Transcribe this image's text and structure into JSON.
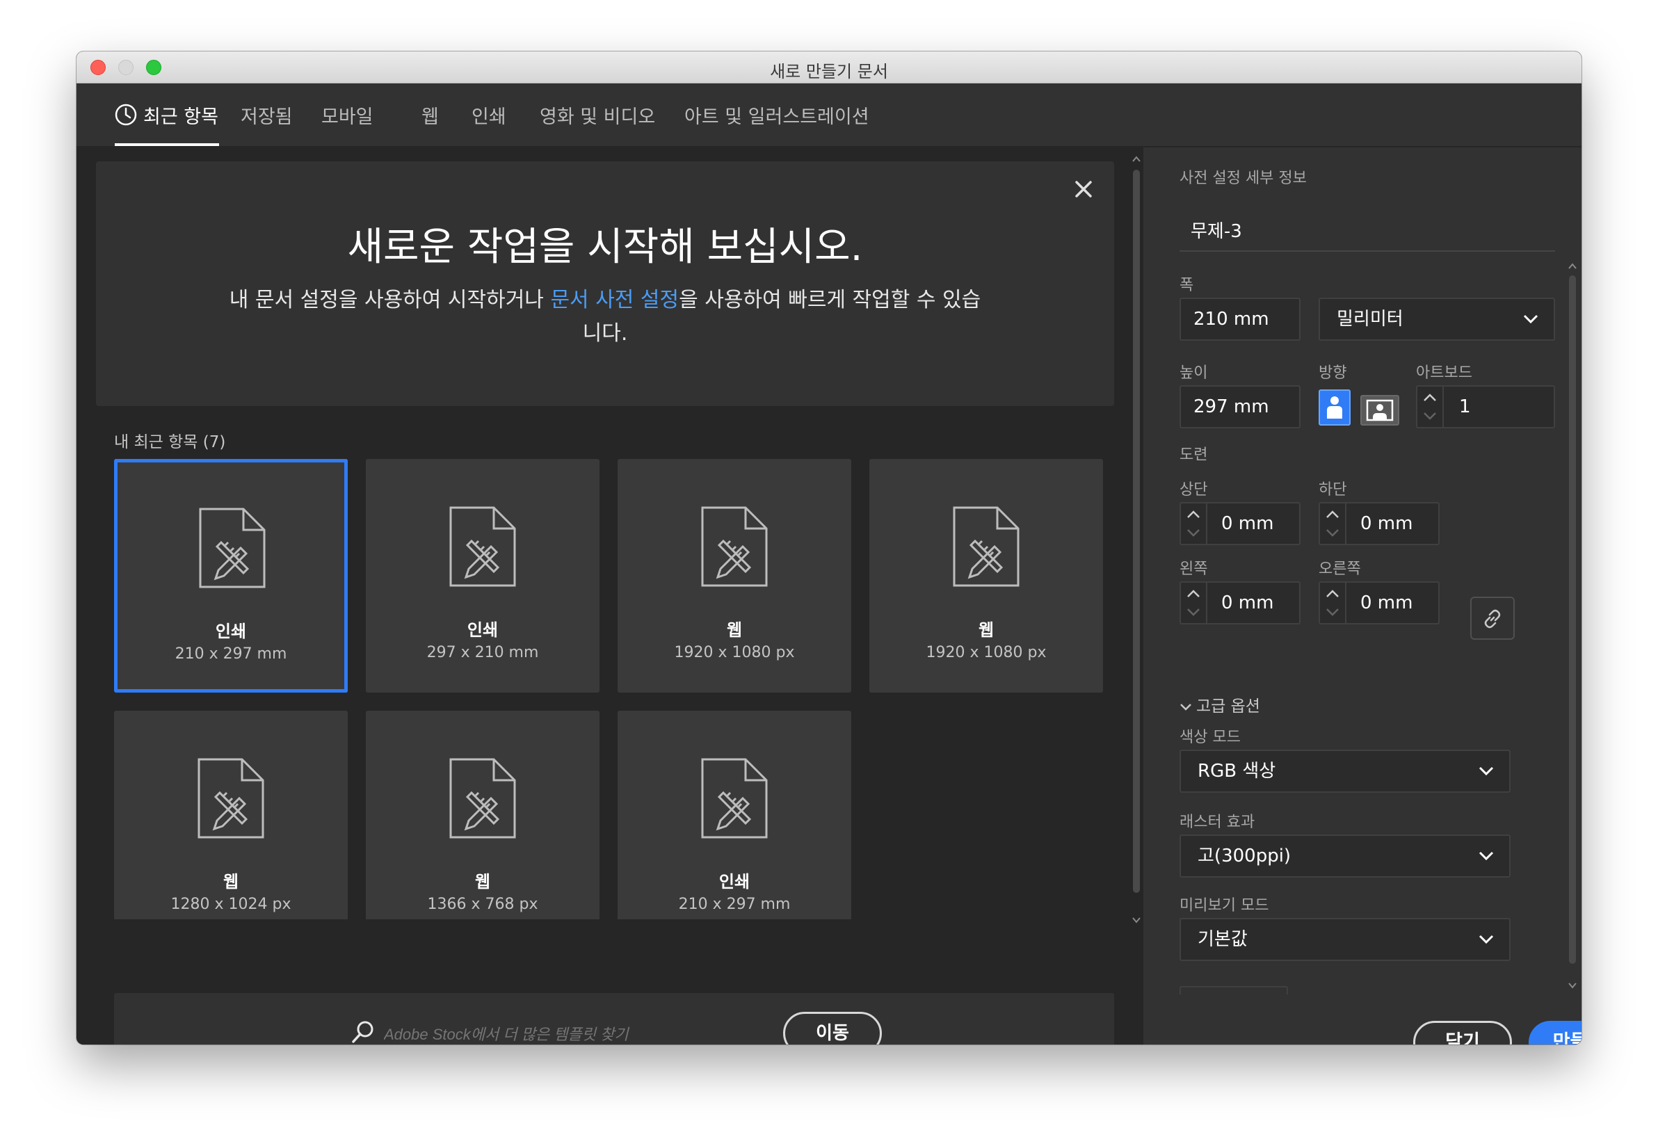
{
  "window": {
    "title": "새로 만들기 문서"
  },
  "tabs": [
    {
      "label": "최근 항목",
      "active": true
    },
    {
      "label": "저장됨"
    },
    {
      "label": "모바일"
    },
    {
      "label": "웹"
    },
    {
      "label": "인쇄"
    },
    {
      "label": "영화 및 비디오"
    },
    {
      "label": "아트 및 일러스트레이션"
    }
  ],
  "hero": {
    "title": "새로운 작업을 시작해 보십시오.",
    "subtitle_before": "내 문서 설정을 사용하여 시작하거나 ",
    "subtitle_link": "문서 사전 설정",
    "subtitle_after": "을 사용하여 빠르게 작업할 수 있습니다."
  },
  "recent": {
    "label": "내 최근 항목",
    "count": "(7)",
    "items": [
      {
        "name": "인쇄",
        "size": "210 x 297 mm",
        "selected": true
      },
      {
        "name": "인쇄",
        "size": "297 x 210 mm"
      },
      {
        "name": "웹",
        "size": "1920 x 1080 px"
      },
      {
        "name": "웹",
        "size": "1920 x 1080 px"
      },
      {
        "name": "웹",
        "size": "1280 x 1024 px"
      },
      {
        "name": "웹",
        "size": "1366 x 768 px"
      },
      {
        "name": "인쇄",
        "size": "210 x 297 mm"
      }
    ]
  },
  "search": {
    "placeholder": "Adobe Stock에서 더 많은 템플릿 찾기",
    "go_label": "이동"
  },
  "preset": {
    "section_label": "사전 설정 세부 정보",
    "name": "무제-3",
    "width_label": "폭",
    "width_value": "210 mm",
    "unit_value": "밀리미터",
    "height_label": "높이",
    "height_value": "297 mm",
    "orientation_label": "방향",
    "orientation": "portrait",
    "artboard_label": "아트보드",
    "artboard_value": "1",
    "bleed_label": "도련",
    "top_label": "상단",
    "top_value": "0 mm",
    "bottom_label": "하단",
    "bottom_value": "0 mm",
    "left_label": "왼쪽",
    "left_value": "0 mm",
    "right_label": "오른쪽",
    "right_value": "0 mm",
    "advanced_label": "고급 옵션",
    "color_mode_label": "색상 모드",
    "color_mode_value": "RGB 색상",
    "raster_label": "래스터 효과",
    "raster_value": "고(300ppi)",
    "preview_label": "미리보기 모드",
    "preview_value": "기본값"
  },
  "actions": {
    "close_label": "닫기",
    "create_label": "만들기"
  },
  "colors": {
    "accent": "#2f7cf6",
    "link": "#4b9cf5",
    "panel": "#323232",
    "background": "#262626"
  }
}
